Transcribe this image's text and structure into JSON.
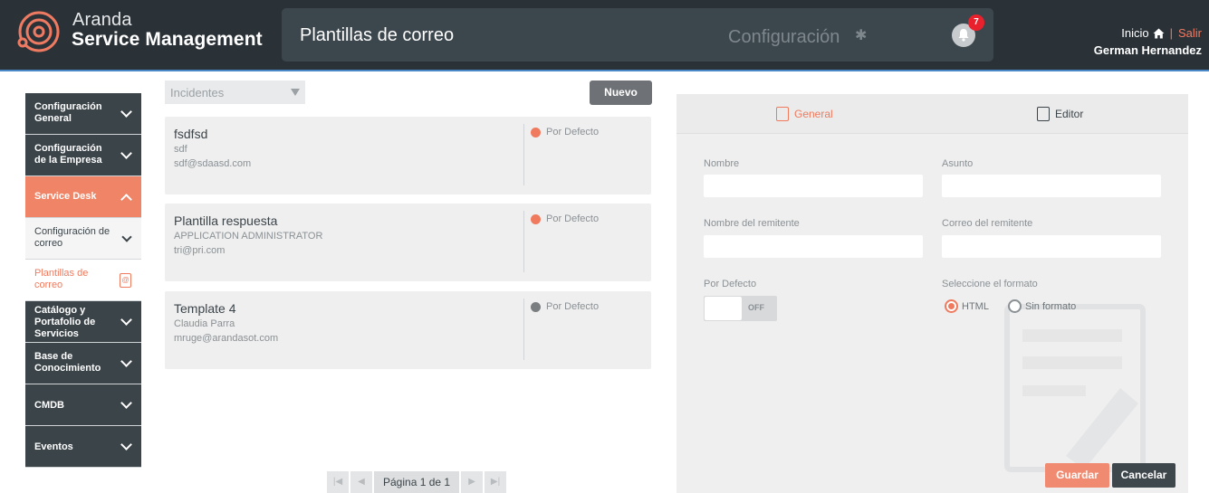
{
  "header": {
    "brand_top": "Aranda",
    "brand_bottom": "Service Management",
    "page_title": "Plantillas de correo",
    "config_label": "Configuración",
    "notification_count": "7",
    "home_label": "Inicio",
    "separator": "|",
    "logout_label": "Salir",
    "user_name": "German Hernandez"
  },
  "sidebar": {
    "items": [
      {
        "label": "Configuración General"
      },
      {
        "label": "Configuración de la Empresa"
      },
      {
        "label": "Service Desk"
      },
      {
        "label": "Configuración de correo"
      },
      {
        "label": "Plantillas de correo"
      },
      {
        "label": "Catálogo y Portafolio de Servicios"
      },
      {
        "label": "Base de Conocimiento"
      },
      {
        "label": "CMDB"
      },
      {
        "label": "Eventos"
      }
    ]
  },
  "list": {
    "filter_value": "Incidentes",
    "new_button": "Nuevo",
    "templates": [
      {
        "name": "fsdfsd",
        "from": "sdf",
        "email": "sdf@sdaasd.com",
        "default_label": "Por Defecto",
        "dot_color": "#f07a5e"
      },
      {
        "name": "Plantilla respuesta",
        "from": "APPLICATION ADMINISTRATOR",
        "email": "tri@pri.com",
        "default_label": "Por Defecto",
        "dot_color": "#f07a5e"
      },
      {
        "name": "Template 4",
        "from": "Claudia Parra",
        "email": "mruge@arandasot.com",
        "default_label": "Por Defecto",
        "dot_color": "#7a7e81"
      }
    ],
    "pagination": {
      "label": "Página 1 de 1"
    }
  },
  "form": {
    "tabs": [
      {
        "label": "General"
      },
      {
        "label": "Editor"
      }
    ],
    "fields": {
      "nombre_label": "Nombre",
      "asunto_label": "Asunto",
      "remitente_label": "Nombre del remitente",
      "correo_label": "Correo del remitente",
      "defecto_label": "Por Defecto",
      "toggle_value": "OFF",
      "formato_label": "Seleccione el formato",
      "format_options": [
        {
          "label": "HTML",
          "selected": true
        },
        {
          "label": "Sin formato",
          "selected": false
        }
      ]
    },
    "save_button": "Guardar",
    "cancel_button": "Cancelar"
  },
  "colors": {
    "accent": "#f07a5e",
    "dark": "#3b4449"
  }
}
